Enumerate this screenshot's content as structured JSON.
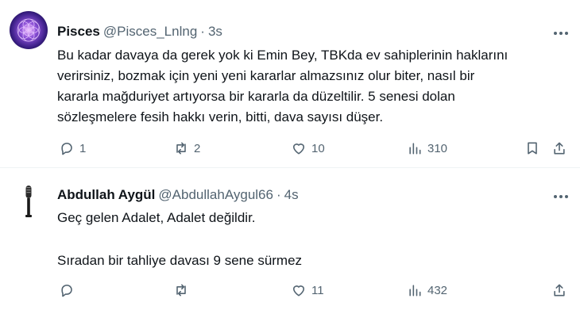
{
  "tweets": [
    {
      "name": "Pisces",
      "handle": "@Pisces_Lnlng",
      "dot": "·",
      "time": "3s",
      "lines": [
        "Bu kadar davaya da gerek yok ki Emin Bey, TBKda ev sahiplerinin haklarını",
        "verirsiniz, bozmak için yeni yeni kararlar almazsınız olur biter, nasıl bir",
        "kararla mağduriyet artıyorsa bir kararla da düzeltilir. 5 senesi dolan",
        "sözleşmelere fesih hakkı verin, bitti, dava sayısı düşer."
      ],
      "replies": "1",
      "retweets": "2",
      "likes": "10",
      "views": "310"
    },
    {
      "name": "Abdullah Aygül",
      "handle": "@AbdullahAygul66",
      "dot": "·",
      "time": "4s",
      "lines": [
        "Geç gelen Adalet, Adalet değildir.",
        "",
        "Sıradan bir tahliye davası 9 sene sürmez"
      ],
      "replies": "",
      "retweets": "",
      "likes": "11",
      "views": "432"
    }
  ],
  "icons": {
    "more": "more-dots-icon",
    "reply": "reply-icon",
    "retweet": "retweet-icon",
    "like": "heart-icon",
    "views": "views-chart-icon",
    "bookmark": "bookmark-icon",
    "share": "share-icon"
  },
  "colors": {
    "text": "#0f1419",
    "secondary": "#536471",
    "divider": "#eff3f4"
  }
}
